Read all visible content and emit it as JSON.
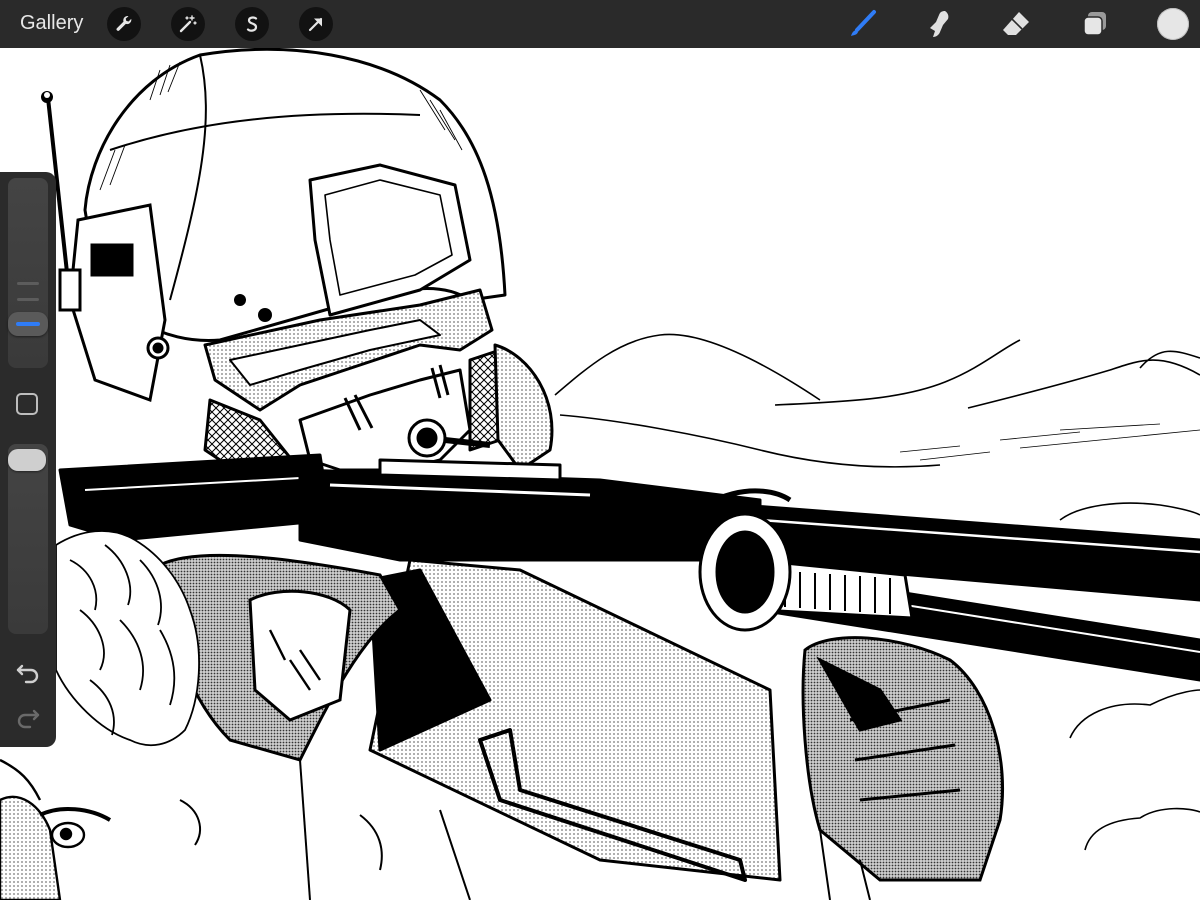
{
  "toolbar": {
    "gallery_label": "Gallery",
    "actions": [
      {
        "name": "actions-wrench-icon"
      },
      {
        "name": "adjustments-magic-wand-icon"
      },
      {
        "name": "selection-s-icon"
      },
      {
        "name": "transform-arrow-icon"
      }
    ],
    "tools": [
      {
        "name": "brush-icon",
        "active": true
      },
      {
        "name": "smudge-icon",
        "active": false
      },
      {
        "name": "eraser-icon",
        "active": false
      },
      {
        "name": "layers-icon",
        "active": false
      }
    ],
    "current_color": "#e6e6e6"
  },
  "sidebar": {
    "brush_size_slider": "size",
    "brush_opacity_slider": "opacity",
    "modify_button": "modify",
    "undo": "undo",
    "redo": "redo"
  },
  "colors": {
    "toolbar_bg": "#2a2a2a",
    "accent": "#2f7cf6",
    "canvas_bg": "#ffffff",
    "ink": "#000000"
  }
}
